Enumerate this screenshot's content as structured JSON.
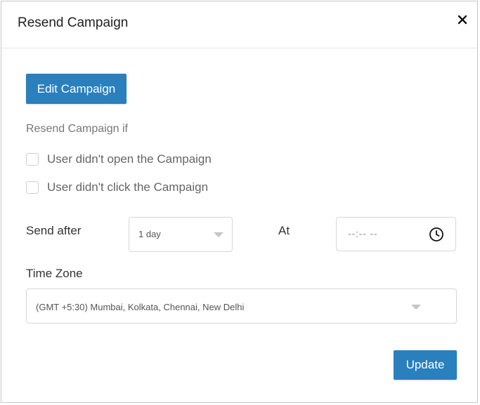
{
  "dialog": {
    "title": "Resend Campaign",
    "close_icon": "close-icon"
  },
  "edit_button": {
    "label": "Edit Campaign"
  },
  "resend_conditions": {
    "label": "Resend Campaign if",
    "options": [
      {
        "label": "User didn't open the Campaign",
        "checked": false
      },
      {
        "label": "User didn't click the Campaign",
        "checked": false
      }
    ]
  },
  "send_after": {
    "label": "Send after",
    "value": "1 day"
  },
  "at": {
    "label": "At",
    "value": "--:-- --",
    "icon": "clock-icon"
  },
  "time_zone": {
    "label": "Time Zone",
    "value": "(GMT +5:30) Mumbai, Kolkata, Chennai, New Delhi"
  },
  "update_button": {
    "label": "Update"
  },
  "colors": {
    "primary": "#2a7fbd",
    "border": "#d6d6d6",
    "muted_text": "#777777"
  }
}
